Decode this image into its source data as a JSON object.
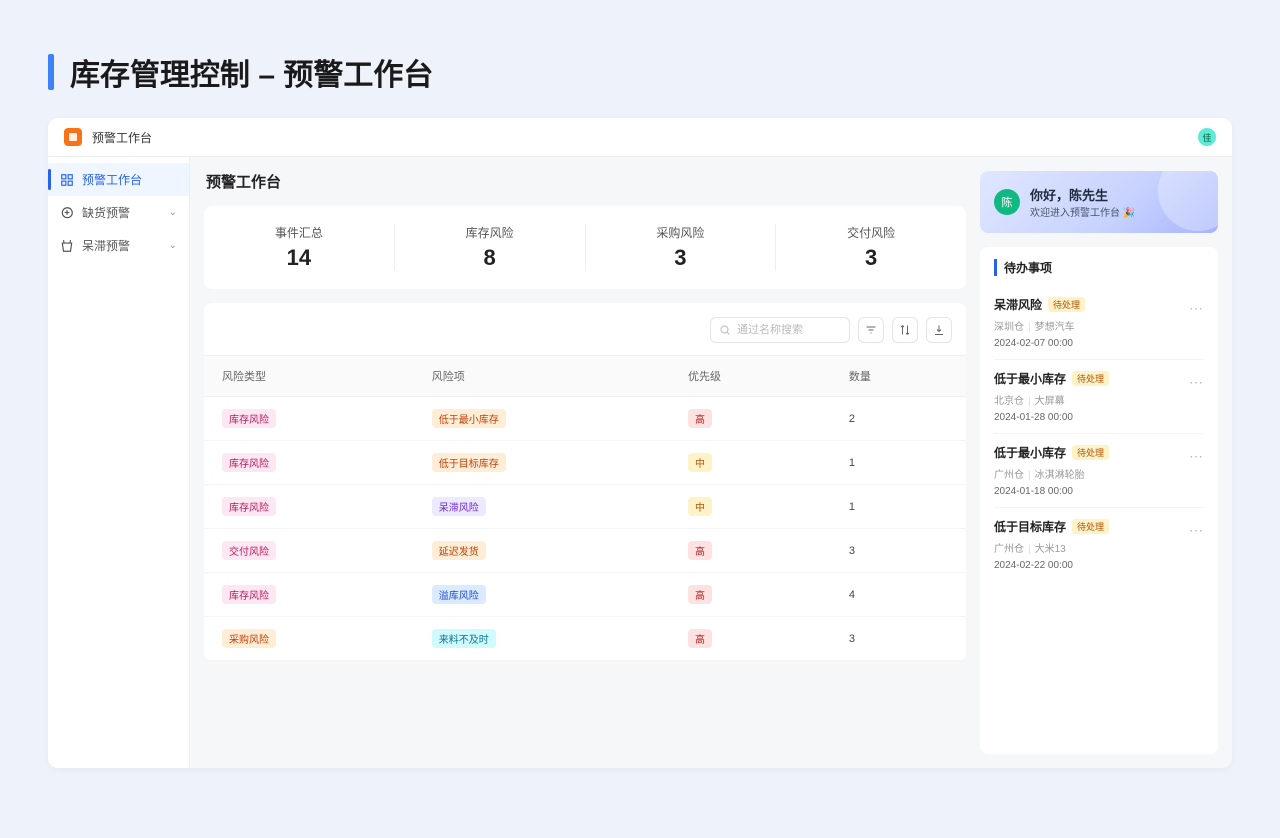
{
  "page_title": "库存管理控制 – 预警工作台",
  "header": {
    "title": "预警工作台",
    "avatar_initial": "佳"
  },
  "sidebar": {
    "items": [
      {
        "label": "预警工作台",
        "active": true,
        "expandable": false
      },
      {
        "label": "缺货预警",
        "active": false,
        "expandable": true
      },
      {
        "label": "呆滞预警",
        "active": false,
        "expandable": true
      }
    ]
  },
  "main": {
    "title": "预警工作台",
    "stats": [
      {
        "label": "事件汇总",
        "value": "14"
      },
      {
        "label": "库存风险",
        "value": "8"
      },
      {
        "label": "采购风险",
        "value": "3"
      },
      {
        "label": "交付风险",
        "value": "3"
      }
    ],
    "search_placeholder": "通过名称搜索",
    "columns": [
      "风险类型",
      "风险项",
      "优先级",
      "数量"
    ],
    "rows": [
      {
        "type": "库存风险",
        "type_style": "pink",
        "item": "低于最小库存",
        "item_style": "orange",
        "priority": "高",
        "priority_style": "high",
        "count": "2"
      },
      {
        "type": "库存风险",
        "type_style": "pink",
        "item": "低于目标库存",
        "item_style": "orange",
        "priority": "中",
        "priority_style": "mid",
        "count": "1"
      },
      {
        "type": "库存风险",
        "type_style": "pink",
        "item": "呆滞风险",
        "item_style": "purple",
        "priority": "中",
        "priority_style": "mid",
        "count": "1"
      },
      {
        "type": "交付风险",
        "type_style": "pink",
        "item": "延迟发货",
        "item_style": "orange",
        "priority": "高",
        "priority_style": "high",
        "count": "3"
      },
      {
        "type": "库存风险",
        "type_style": "pink",
        "item": "溢库风险",
        "item_style": "blue",
        "priority": "高",
        "priority_style": "high",
        "count": "4"
      },
      {
        "type": "采购风险",
        "type_style": "orange",
        "item": "来料不及时",
        "item_style": "cyan",
        "priority": "高",
        "priority_style": "high",
        "count": "3"
      }
    ]
  },
  "greeting": {
    "avatar_char": "陈",
    "hello": "你好，陈先生",
    "welcome": "欢迎进入预警工作台 🎉"
  },
  "todo": {
    "title": "待办事项",
    "status_label": "待处理",
    "items": [
      {
        "name": "呆滞风险",
        "loc": "深圳仓",
        "sku": "梦想汽车",
        "time": "2024-02-07 00:00"
      },
      {
        "name": "低于最小库存",
        "loc": "北京仓",
        "sku": "大屏幕",
        "time": "2024-01-28 00:00"
      },
      {
        "name": "低于最小库存",
        "loc": "广州仓",
        "sku": "冰淇淋轮胎",
        "time": "2024-01-18 00:00"
      },
      {
        "name": "低于目标库存",
        "loc": "广州仓",
        "sku": "大米13",
        "time": "2024-02-22 00:00"
      }
    ]
  }
}
